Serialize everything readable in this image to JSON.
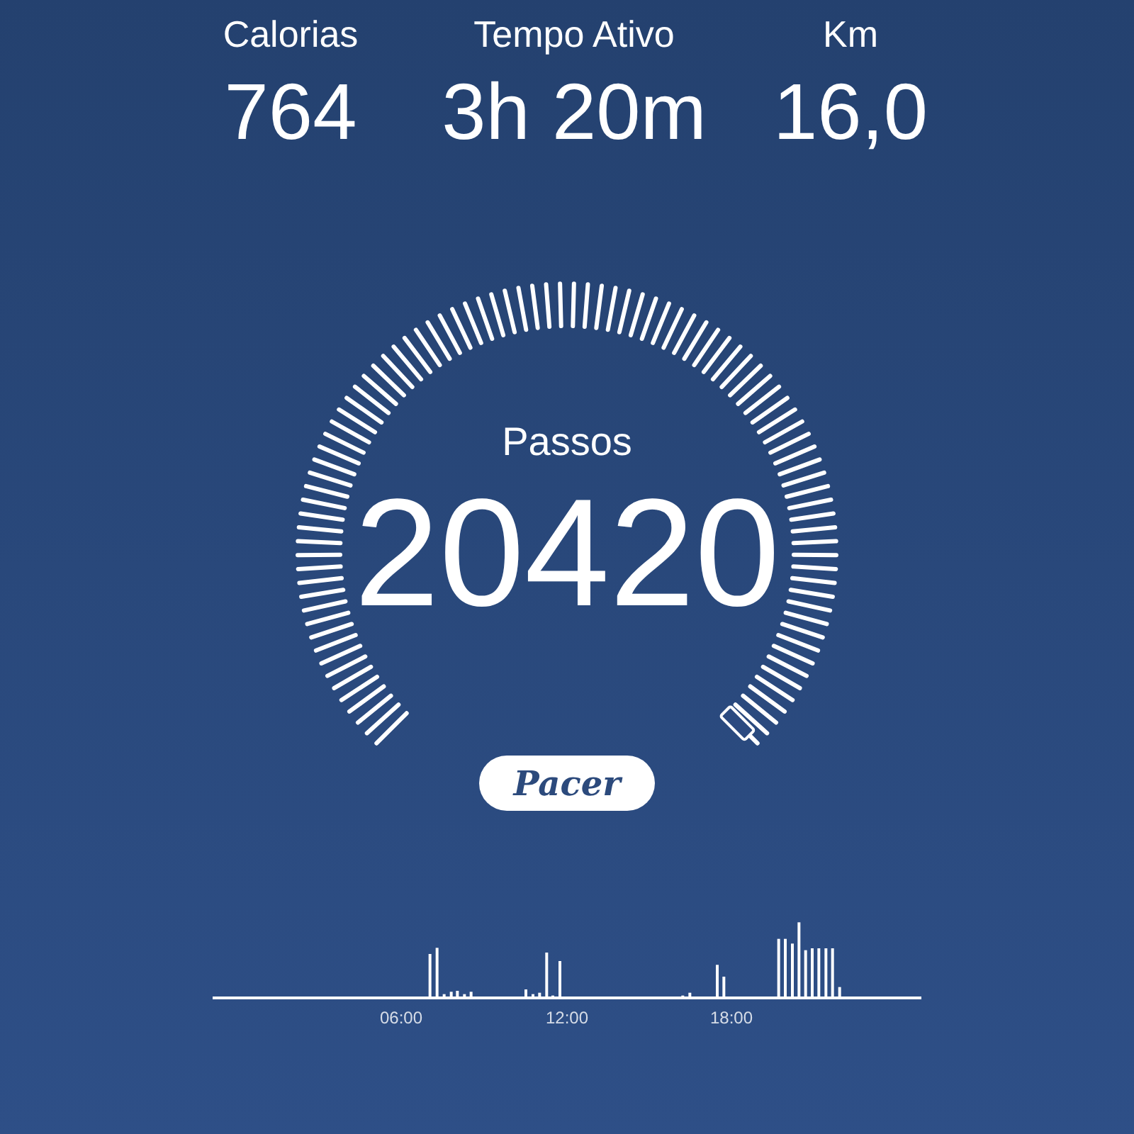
{
  "stats": [
    {
      "label": "Calorias",
      "value": "764"
    },
    {
      "label": "Tempo Ativo",
      "value": "3h 20m"
    },
    {
      "label": "Km",
      "value": "16,0"
    }
  ],
  "gauge": {
    "label": "Passos",
    "value": "20420"
  },
  "logo": "Pacer",
  "activity_chart": {
    "x_labels": [
      "06:00",
      "12:00",
      "18:00"
    ]
  }
}
